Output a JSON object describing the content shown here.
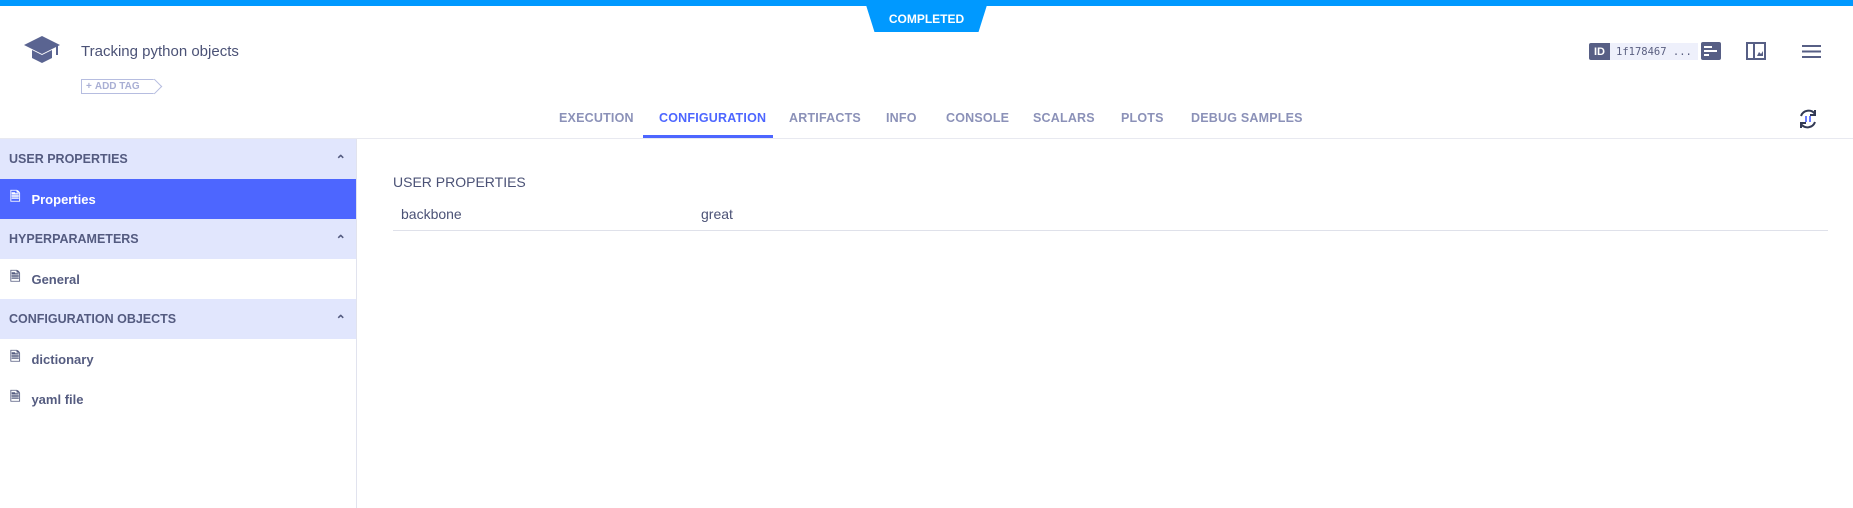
{
  "status": "COMPLETED",
  "header": {
    "title": "Tracking python objects",
    "add_tag": "ADD TAG",
    "id_label": "ID",
    "id_value": "1f178467 ..."
  },
  "tabs": [
    {
      "label": "EXECUTION",
      "active": false
    },
    {
      "label": "CONFIGURATION",
      "active": true
    },
    {
      "label": "ARTIFACTS",
      "active": false
    },
    {
      "label": "INFO",
      "active": false
    },
    {
      "label": "CONSOLE",
      "active": false
    },
    {
      "label": "SCALARS",
      "active": false
    },
    {
      "label": "PLOTS",
      "active": false
    },
    {
      "label": "DEBUG SAMPLES",
      "active": false
    }
  ],
  "sidebar": {
    "sections": [
      {
        "title": "USER PROPERTIES",
        "items": [
          "Properties"
        ]
      },
      {
        "title": "HYPERPARAMETERS",
        "items": [
          "General"
        ]
      },
      {
        "title": "CONFIGURATION OBJECTS",
        "items": [
          "dictionary",
          "yaml file"
        ]
      }
    ],
    "selected": "Properties"
  },
  "content": {
    "heading": "USER PROPERTIES",
    "rows": [
      {
        "key": "backbone",
        "value": "great"
      }
    ]
  },
  "colors": {
    "accent": "#4d66ff",
    "status_bar": "#0099ff",
    "section_bg": "#e1e6fd"
  }
}
